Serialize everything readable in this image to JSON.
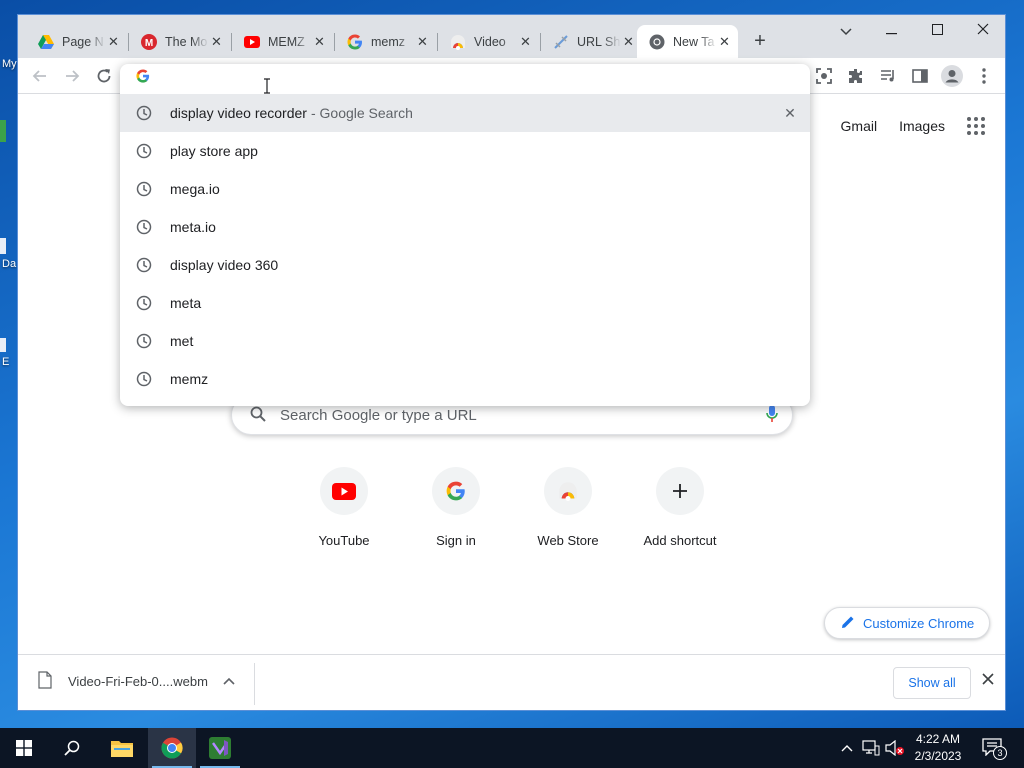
{
  "desktop": {
    "fragments": [
      "My",
      "Da",
      "E"
    ]
  },
  "tabs": [
    {
      "title": "Page N",
      "icon": "google-drive-icon"
    },
    {
      "title": "The Mo",
      "icon": "mega-icon"
    },
    {
      "title": "MEMZ",
      "icon": "youtube-icon"
    },
    {
      "title": "memz",
      "icon": "google-icon"
    },
    {
      "title": "Video",
      "icon": "chrome-web-store-icon"
    },
    {
      "title": "URL Sh",
      "icon": "url-shortener-icon"
    },
    {
      "title": "New Ta",
      "icon": "chrome-icon"
    }
  ],
  "omnibox": {
    "value": "",
    "suggestions": [
      {
        "text": "display video recorder",
        "sub": "- Google Search"
      },
      {
        "text": "play store app",
        "sub": ""
      },
      {
        "text": "mega.io",
        "sub": ""
      },
      {
        "text": "meta.io",
        "sub": ""
      },
      {
        "text": "display video 360",
        "sub": ""
      },
      {
        "text": "meta",
        "sub": ""
      },
      {
        "text": "met",
        "sub": ""
      },
      {
        "text": "memz",
        "sub": ""
      }
    ]
  },
  "page": {
    "gmail": "Gmail",
    "images": "Images",
    "search_placeholder": "Search Google or type a URL",
    "shortcuts": [
      "YouTube",
      "Sign in",
      "Web Store",
      "Add shortcut"
    ],
    "customize": "Customize Chrome"
  },
  "downloads": {
    "file": "Video-Fri-Feb-0....webm",
    "show_all": "Show all"
  },
  "taskbar": {
    "time": "4:22 AM",
    "date": "2/3/2023",
    "notifications": "3"
  },
  "colors": {
    "accent": "#1a73e8",
    "youtube": "#ff0000",
    "taskbar": "#0c1524"
  }
}
